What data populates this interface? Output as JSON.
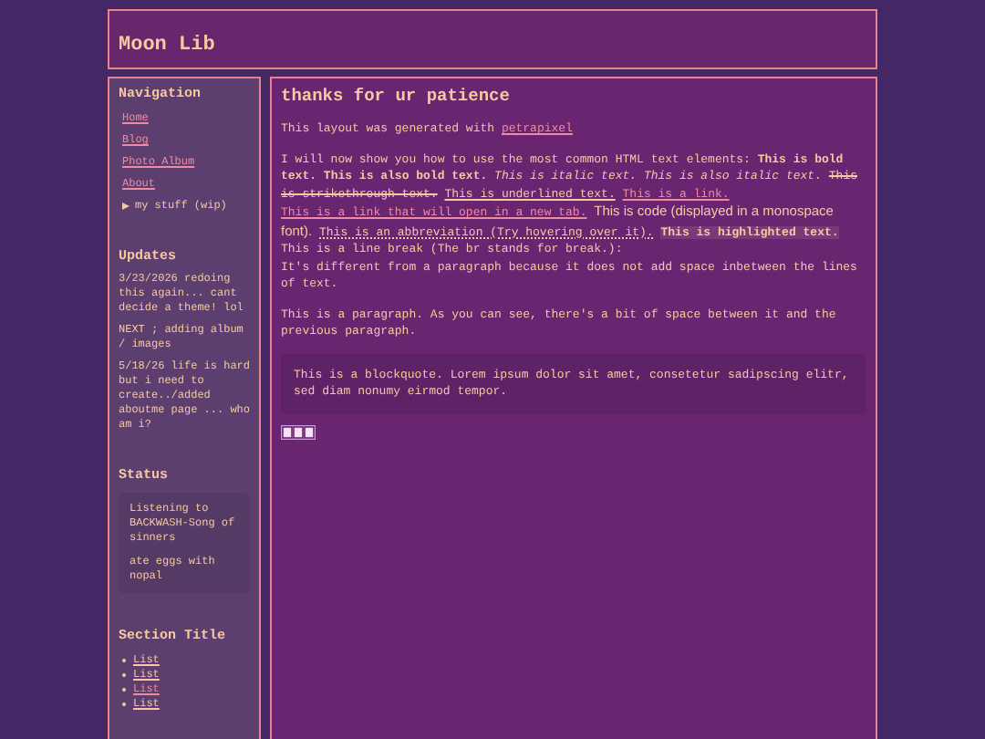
{
  "header": {
    "title": "Moon Lib"
  },
  "sidebar": {
    "navigation": {
      "title": "Navigation",
      "items": [
        {
          "label": "Home",
          "kind": "link"
        },
        {
          "label": "Blog",
          "kind": "link"
        },
        {
          "label": "Photo Album",
          "kind": "link"
        },
        {
          "label": "About",
          "kind": "link"
        },
        {
          "label": "my stuff (wip)",
          "kind": "toggle",
          "expanded": false
        }
      ]
    },
    "updates": {
      "title": "Updates",
      "entries": [
        "3/23/2026 redoing this again... cant decide a theme! lol",
        "NEXT ; adding album / images",
        "5/18/26 life is hard but i need to create../added aboutme page ... who am i?"
      ]
    },
    "status": {
      "title": "Status",
      "lines": [
        "Listening to BACKWASH-Song of sinners",
        "ate eggs with nopal"
      ]
    },
    "section": {
      "title": "Section Title",
      "items": [
        {
          "label": "List",
          "selected": false
        },
        {
          "label": "List",
          "selected": false
        },
        {
          "label": "List",
          "selected": true
        },
        {
          "label": "List",
          "selected": false
        }
      ]
    }
  },
  "main": {
    "title": "thanks for ur patience",
    "paragraphs": [
      [
        {
          "kind": "text",
          "text": "This layout was generated with"
        },
        {
          "kind": "link",
          "text": "petrapixel"
        }
      ],
      [
        {
          "kind": "text",
          "text": "I will now show you how to use the most common HTML text elements:"
        },
        {
          "kind": "bold",
          "text": "This is bold text."
        },
        {
          "kind": "bold",
          "text": "This is also bold text."
        },
        {
          "kind": "italic",
          "text": "This is italic text."
        },
        {
          "kind": "italic",
          "text": "This is also italic text."
        },
        {
          "kind": "strike",
          "text": "This is strikethrough text."
        },
        {
          "kind": "underline",
          "text": "This is underlined text."
        },
        {
          "kind": "link",
          "text": "This is a link."
        },
        {
          "kind": "link",
          "text": "This is a link that will open in a new tab."
        },
        {
          "kind": "code",
          "text": "This is code (displayed in a monospace font)."
        },
        {
          "kind": "abbr",
          "text": "This is an abbreviation (Try hovering over it)."
        },
        {
          "kind": "mark",
          "text": "This is highlighted text."
        },
        {
          "kind": "text",
          "text": "This is a line break (The br stands for break.):"
        },
        {
          "kind": "br"
        },
        {
          "kind": "text",
          "text": "It's different from a paragraph because it does not add space inbetween the lines of text."
        }
      ],
      [
        {
          "kind": "text",
          "text": "This is a paragraph. As you can see, there's a bit of space between it and the previous paragraph."
        }
      ]
    ],
    "blockquote": "This is a blockquote. Lorem ipsum dolor sit amet, consetetur sadipscing elitr, sed diam nonumy eirmod tempor."
  }
}
